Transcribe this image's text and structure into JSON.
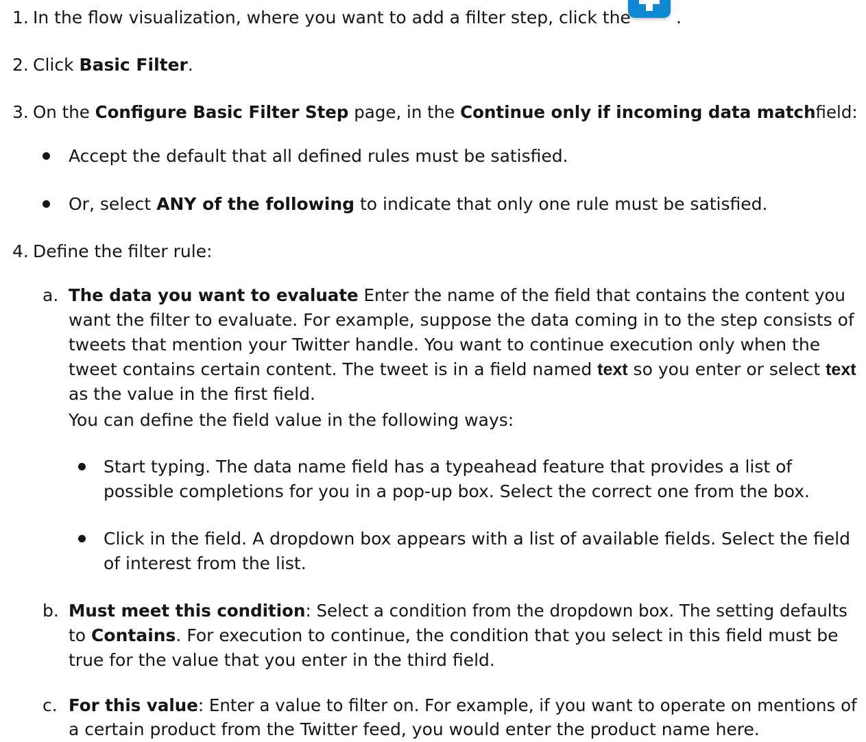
{
  "steps": {
    "s1": {
      "num": "1.",
      "text_a": "In the flow visualization, where you want to add a filter step, click the",
      "text_b": "."
    },
    "s2": {
      "num": "2.",
      "text_a": "Click ",
      "bold": "Basic Filter",
      "text_b": "."
    },
    "s3": {
      "num": "3.",
      "text_a": "On the ",
      "bold_a": "Configure Basic Filter Step",
      "text_b": " page, in the ",
      "bold_b": "Continue only if incoming data match",
      "text_c": "field:"
    },
    "s3_bullets": [
      {
        "text": "Accept the default that all defined rules must be satisfied."
      },
      {
        "text_a": "Or, select ",
        "bold": "ANY of the following",
        "text_b": " to indicate that only one rule must be satisfied."
      }
    ],
    "s4": {
      "num": "4.",
      "text": "Define the filter rule:"
    }
  },
  "substeps": {
    "a": {
      "letter": "a.",
      "bold": "The data you want to evaluate",
      "l1": " Enter the name of the field that contains the content you",
      "l2": "want the filter to evaluate. For example, suppose the data coming in to the step consists of",
      "l3": "tweets that mention your Twitter handle. You want to continue execution only when the",
      "l4a": "tweet contains certain content. The tweet is in a field named ",
      "l4b": "text",
      "l4c": " so you enter or select ",
      "l4d": "text",
      "l5": "as the value in the first field.",
      "l6": "You can define the field value in the following ways:",
      "bullets": [
        {
          "l1": "Start typing. The data name field has a typeahead feature that provides a list of",
          "l2": "possible completions for you in a pop-up box. Select the correct one from the box."
        },
        {
          "l1": "Click in the field. A dropdown box appears with a list of available fields. Select the field",
          "l2": "of interest from the list."
        }
      ]
    },
    "b": {
      "letter": "b.",
      "bold": "Must meet this condition",
      "l1": ": Select a condition from the dropdown box. The setting defaults",
      "l2a": "to ",
      "l2b": "Contains",
      "l2c": ". For execution to continue, the condition that you select in this field must be",
      "l3": "true for the value that you enter in the third field."
    },
    "c": {
      "letter": "c.",
      "bold": "For this value",
      "l1": ": Enter a value to filter on. For example, if you want to operate on mentions of",
      "l2": "a certain product from the Twitter feed, you would enter the product name here."
    }
  },
  "icons": {
    "add_step": "plus-icon"
  },
  "colors": {
    "text": "#151515",
    "icon_blue": "#0e88d3"
  }
}
